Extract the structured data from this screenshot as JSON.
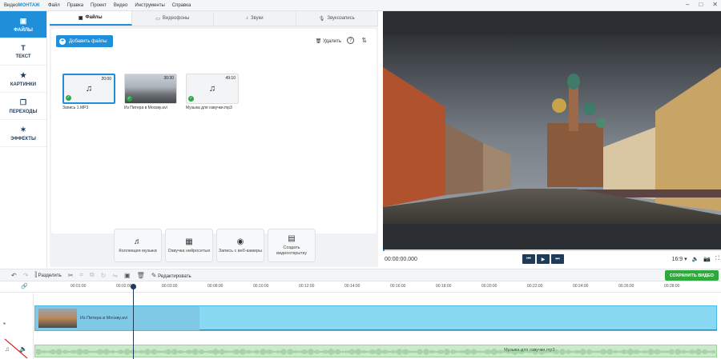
{
  "menubar": {
    "app_name_prefix": "Видео",
    "app_name_brand": "МОНТАЖ",
    "items": [
      "Файл",
      "Правка",
      "Проект",
      "Видео",
      "Инструменты",
      "Справка"
    ]
  },
  "sidebar": {
    "items": [
      {
        "label": "ФАЙЛЫ",
        "icon": "files-icon"
      },
      {
        "label": "ТЕКСТ",
        "icon": "text-icon"
      },
      {
        "label": "КАРТИНКИ",
        "icon": "star-icon"
      },
      {
        "label": "ПЕРЕХОДЫ",
        "icon": "transitions-icon"
      },
      {
        "label": "ЭФФЕКТЫ",
        "icon": "wand-icon"
      }
    ]
  },
  "tabs": [
    "Файлы",
    "Видеофоны",
    "Звуки",
    "Звукозапись"
  ],
  "files_panel": {
    "add_button": "Добавить файлы",
    "delete_label": "Удалить",
    "help": "?",
    "files": [
      {
        "name": "Запись 1.MP3",
        "duration": "20:00",
        "type": "audio",
        "selected": true
      },
      {
        "name": "Из Питера в Москву.avi",
        "duration": "30:30",
        "type": "video",
        "selected": false
      },
      {
        "name": "Музыка для озвучки.mp3",
        "duration": "49:10",
        "type": "audio",
        "selected": false
      }
    ]
  },
  "tools": [
    {
      "label": "Коллекция музыки",
      "icon": "music-collection-icon"
    },
    {
      "label": "Озвучка нейросетью",
      "icon": "ai-voice-icon"
    },
    {
      "label": "Запись с веб-камеры",
      "icon": "webcam-icon"
    },
    {
      "label": "Создать видеооткрытку",
      "icon": "postcard-icon"
    }
  ],
  "preview": {
    "time": "00:00:00.000",
    "aspect": "16:9",
    "progress_fraction": 0.0
  },
  "timeline_toolbar": {
    "split": "Разделить",
    "edit": "Редактировать",
    "save": "СОХРАНИТЬ ВИДЕО"
  },
  "ruler": {
    "labels": [
      "00:01:00",
      "00:02:00",
      "00:03:00",
      "00:08:00",
      "00:10:00",
      "00:12:00",
      "00:14:00",
      "00:16:00",
      "00:18:00",
      "00:20:00",
      "00:22:00",
      "00:24:00",
      "00:26:00",
      "00:28:00"
    ]
  },
  "timeline": {
    "video_clip_title": "Из Питера в Москву.avi",
    "audio_clip_title": "Музыка для озвучки.mp3"
  },
  "colors": {
    "accent": "#1e8fd8",
    "save_green": "#2eaa3c",
    "dark_navy": "#1f3b5a",
    "video_clip": "#8ad9f3",
    "audio_clip": "#cde9cd"
  }
}
